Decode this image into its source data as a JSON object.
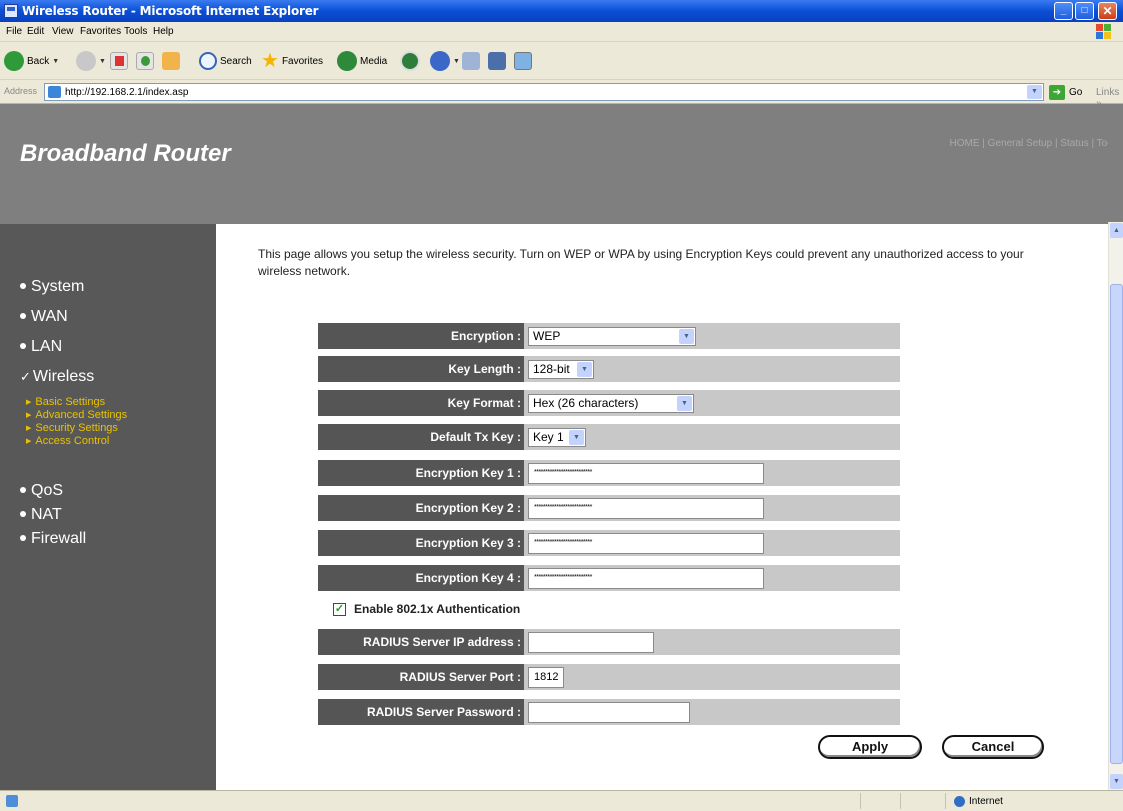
{
  "window": {
    "title": "Wireless Router - Microsoft Internet Explorer",
    "controls": [
      "_",
      "□",
      "✕"
    ]
  },
  "menu": [
    "File",
    "Edit",
    "View",
    "Favorites",
    "Tools",
    "Help"
  ],
  "toolbar": {
    "back_label": "Back",
    "search_label": "Search",
    "favorites_label": "Favorites",
    "media_label": "Media"
  },
  "address": {
    "label": "Address",
    "url": "http://192.168.2.1/index.asp",
    "go_label": "Go",
    "links_label": "Links »"
  },
  "router": {
    "brand": "Broadband Router",
    "topnav": "HOME | General Setup | Status | Tools"
  },
  "sidebar": {
    "items": [
      {
        "label": "System"
      },
      {
        "label": "WAN"
      },
      {
        "label": "LAN"
      },
      {
        "label": "Wireless"
      },
      {
        "label": "QoS"
      },
      {
        "label": "NAT"
      },
      {
        "label": "Firewall"
      }
    ],
    "subitems": [
      {
        "label": "Basic Settings"
      },
      {
        "label": "Advanced Settings"
      },
      {
        "label": "Security Settings"
      },
      {
        "label": "Access Control"
      }
    ]
  },
  "intro_text": "This page allows you setup the wireless security. Turn on WEP or WPA by using Encryption Keys could prevent any unauthorized access to your wireless network.",
  "form": {
    "encryption": {
      "label": "Encryption :",
      "value": "WEP"
    },
    "key_length": {
      "label": "Key Length :",
      "value": "128-bit"
    },
    "key_format": {
      "label": "Key Format :",
      "value": "Hex (26 characters)"
    },
    "default_tx_key": {
      "label": "Default Tx Key :",
      "value": "Key 1"
    },
    "keys": [
      {
        "label": "Encryption Key 1 :",
        "value": "**************************"
      },
      {
        "label": "Encryption Key 2 :",
        "value": "**************************"
      },
      {
        "label": "Encryption Key 3 :",
        "value": "**************************"
      },
      {
        "label": "Encryption Key 4 :",
        "value": "**************************"
      }
    ],
    "enable_8021x": {
      "label": "Enable 802.1x Authentication",
      "checked": true
    },
    "radius_ip": {
      "label": "RADIUS Server IP address :",
      "value": ""
    },
    "radius_port": {
      "label": "RADIUS Server Port :",
      "value": "1812"
    },
    "radius_password": {
      "label": "RADIUS Server Password :",
      "value": ""
    }
  },
  "buttons": {
    "apply": "Apply",
    "cancel": "Cancel"
  },
  "status": {
    "zone": "Internet"
  },
  "colors": {
    "header": "#7f7f7f",
    "sidebar": "#585858",
    "submenu": "#e8c200",
    "label_cell": "#555555",
    "field_cell": "#c8c8c8",
    "checkmark": "#21a121"
  }
}
